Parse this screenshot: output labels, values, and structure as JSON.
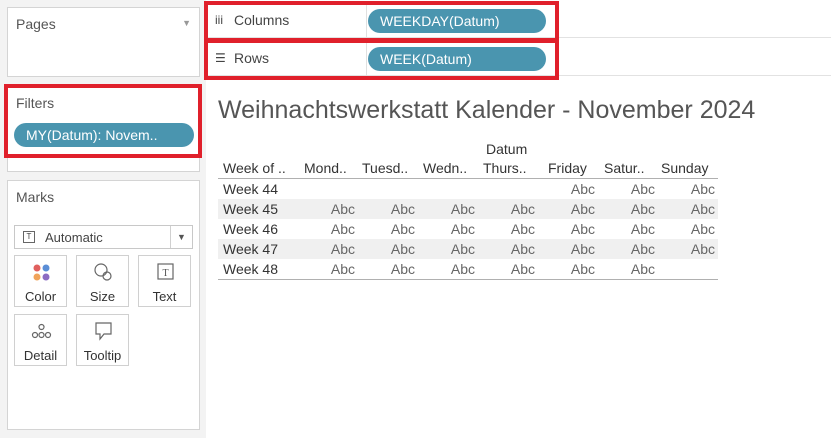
{
  "pages": {
    "title": "Pages"
  },
  "filters": {
    "title": "Filters",
    "pill": "MY(Datum): Novem.."
  },
  "marks": {
    "title": "Marks",
    "mark_type": "Automatic",
    "buttons": [
      {
        "label": "Color",
        "icon": "color-icon"
      },
      {
        "label": "Size",
        "icon": "size-icon"
      },
      {
        "label": "Text",
        "icon": "text-icon"
      },
      {
        "label": "Detail",
        "icon": "detail-icon"
      },
      {
        "label": "Tooltip",
        "icon": "tooltip-icon"
      }
    ]
  },
  "shelves": {
    "columns": {
      "name": "Columns",
      "pill": "WEEKDAY(Datum)"
    },
    "rows": {
      "name": "Rows",
      "pill": "WEEK(Datum)"
    }
  },
  "viz": {
    "title": "Weihnachtswerkstatt Kalender - November 2024",
    "column_field": "Datum",
    "row_header": "Week of ..",
    "columns": [
      "Mond..",
      "Tuesd..",
      "Wedn..",
      "Thurs..",
      "Friday",
      "Satur..",
      "Sunday"
    ],
    "rows": [
      {
        "label": "Week 44",
        "cells": [
          "",
          "",
          "",
          "",
          "Abc",
          "Abc",
          "Abc"
        ]
      },
      {
        "label": "Week 45",
        "cells": [
          "Abc",
          "Abc",
          "Abc",
          "Abc",
          "Abc",
          "Abc",
          "Abc"
        ]
      },
      {
        "label": "Week 46",
        "cells": [
          "Abc",
          "Abc",
          "Abc",
          "Abc",
          "Abc",
          "Abc",
          "Abc"
        ]
      },
      {
        "label": "Week 47",
        "cells": [
          "Abc",
          "Abc",
          "Abc",
          "Abc",
          "Abc",
          "Abc",
          "Abc"
        ]
      },
      {
        "label": "Week 48",
        "cells": [
          "Abc",
          "Abc",
          "Abc",
          "Abc",
          "Abc",
          "Abc",
          ""
        ]
      }
    ]
  },
  "colors": {
    "pill": "#4a95af",
    "highlight": "#e0202b"
  }
}
